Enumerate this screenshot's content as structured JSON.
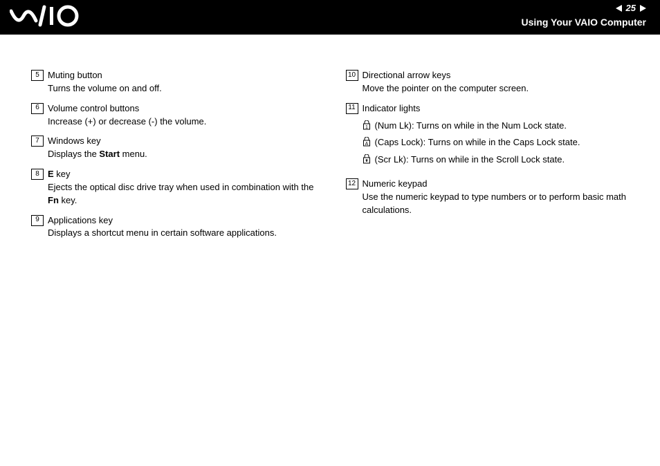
{
  "header": {
    "page_number": "25",
    "section_title": "Using Your VAIO Computer"
  },
  "left_column": [
    {
      "num": "5",
      "title_plain": "Muting button",
      "desc_plain": "Turns the volume on and off."
    },
    {
      "num": "6",
      "title_plain": "Volume control buttons",
      "desc_plain": "Increase (+) or decrease (-) the volume."
    },
    {
      "num": "7",
      "title_plain": "Windows key",
      "desc_prefix": "Displays the ",
      "desc_bold": "Start",
      "desc_suffix": " menu."
    },
    {
      "num": "8",
      "title_bold": "E",
      "title_suffix": " key",
      "desc_prefix": "Ejects the optical disc drive tray when used in combination with the ",
      "desc_bold": "Fn",
      "desc_suffix": " key."
    },
    {
      "num": "9",
      "title_plain": "Applications key",
      "desc_plain": "Displays a shortcut menu in certain software applications."
    }
  ],
  "right_column": [
    {
      "num": "10",
      "title_plain": "Directional arrow keys",
      "desc_plain": "Move the pointer on the computer screen."
    },
    {
      "num": "11",
      "title_plain": "Indicator lights",
      "sub": [
        {
          "letter": "1",
          "text": " (Num Lk): Turns on while in the Num Lock state."
        },
        {
          "letter": "A",
          "text": " (Caps Lock): Turns on while in the Caps Lock state."
        },
        {
          "letter": "⇧",
          "text": " (Scr Lk): Turns on while in the Scroll Lock state."
        }
      ]
    },
    {
      "num": "12",
      "title_plain": "Numeric keypad",
      "desc_plain": "Use the numeric keypad to type numbers or to perform basic math calculations."
    }
  ]
}
